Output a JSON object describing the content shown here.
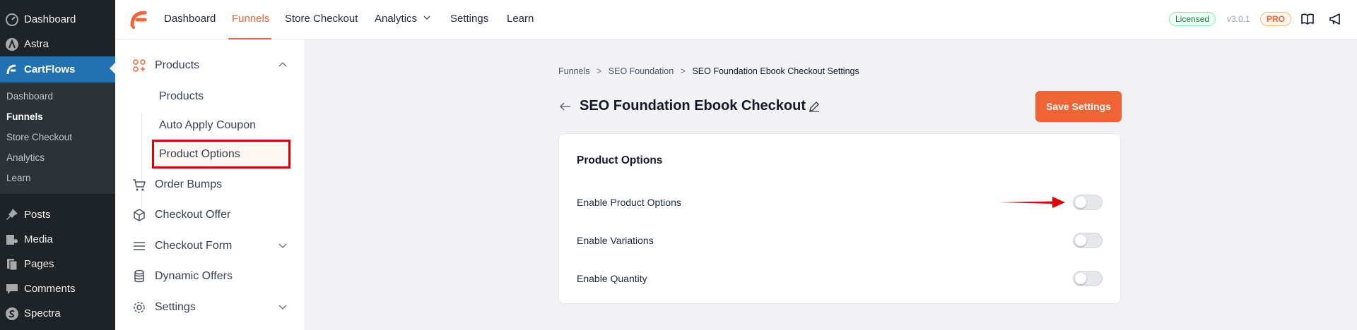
{
  "wp_menu": {
    "items": [
      {
        "label": "Dashboard",
        "icon": "dashboard-icon"
      },
      {
        "label": "Astra",
        "icon": "astra-icon"
      },
      {
        "label": "CartFlows",
        "icon": "cartflows-icon"
      },
      {
        "label": "Posts",
        "icon": "pin-icon"
      },
      {
        "label": "Media",
        "icon": "media-icon"
      },
      {
        "label": "Pages",
        "icon": "pages-icon"
      },
      {
        "label": "Comments",
        "icon": "comment-icon"
      },
      {
        "label": "Spectra",
        "icon": "spectra-icon"
      }
    ],
    "submenu": [
      "Dashboard",
      "Funnels",
      "Store Checkout",
      "Analytics",
      "Learn"
    ],
    "accent": "#2271b1"
  },
  "topbar": {
    "nav": [
      "Dashboard",
      "Funnels",
      "Store Checkout",
      "Analytics",
      "Settings",
      "Learn"
    ],
    "licensed": "Licensed",
    "version": "v3.0.1",
    "pro": "PRO",
    "brand_color": "#f06335"
  },
  "left_nav": {
    "products": "Products",
    "sub": [
      "Products",
      "Auto Apply Coupon",
      "Product Options"
    ],
    "order_bumps": "Order Bumps",
    "checkout_offer": "Checkout Offer",
    "checkout_form": "Checkout Form",
    "dynamic_offers": "Dynamic Offers",
    "settings": "Settings"
  },
  "main": {
    "breadcrumb": [
      "Funnels",
      "SEO Foundation",
      "SEO Foundation Ebook Checkout Settings"
    ],
    "breadcrumb_sep": ">",
    "title": "SEO Foundation Ebook Checkout",
    "save_label": "Save Settings",
    "card_title": "Product Options",
    "options": [
      {
        "label": "Enable Product Options",
        "enabled": false
      },
      {
        "label": "Enable Variations",
        "enabled": false
      },
      {
        "label": "Enable Quantity",
        "enabled": false
      }
    ]
  }
}
